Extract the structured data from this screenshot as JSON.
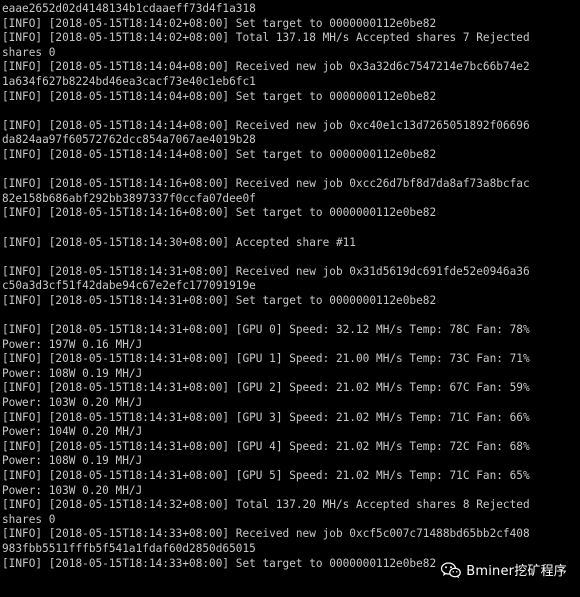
{
  "terminal": {
    "lines": [
      "eaae2652d02d4148134b1cdaaeff73d4f1a318",
      "[INFO] [2018-05-15T18:14:02+08:00] Set target to 0000000112e0be82",
      "[INFO] [2018-05-15T18:14:02+08:00] Total 137.18 MH/s Accepted shares 7 Rejected",
      "shares 0",
      "[INFO] [2018-05-15T18:14:04+08:00] Received new job 0x3a32d6c7547214e7bc66b74e2",
      "1a634f627b8224bd46ea3cacf73e40c1eb6fc1",
      "[INFO] [2018-05-15T18:14:04+08:00] Set target to 0000000112e0be82",
      "",
      "[INFO] [2018-05-15T18:14:14+08:00] Received new job 0xc40e1c13d7265051892f06696",
      "da824aa97f60572762dcc854a7067ae4019b28",
      "[INFO] [2018-05-15T18:14:14+08:00] Set target to 0000000112e0be82",
      "",
      "[INFO] [2018-05-15T18:14:16+08:00] Received new job 0xcc26d7bf8d7da8af73a8bcfac",
      "82e158b686abf292bb3897337f0ccfa07dee0f",
      "[INFO] [2018-05-15T18:14:16+08:00] Set target to 0000000112e0be82",
      "",
      "[INFO] [2018-05-15T18:14:30+08:00] Accepted share #11",
      "",
      "[INFO] [2018-05-15T18:14:31+08:00] Received new job 0x31d5619dc691fde52e0946a36",
      "c50a3d3cf51f42dabe94c67e2efc177091919e",
      "[INFO] [2018-05-15T18:14:31+08:00] Set target to 0000000112e0be82",
      "",
      "[INFO] [2018-05-15T18:14:31+08:00] [GPU 0] Speed: 32.12 MH/s Temp: 78C Fan: 78%",
      "Power: 197W 0.16 MH/J",
      "[INFO] [2018-05-15T18:14:31+08:00] [GPU 1] Speed: 21.00 MH/s Temp: 73C Fan: 71%",
      "Power: 108W 0.19 MH/J",
      "[INFO] [2018-05-15T18:14:31+08:00] [GPU 2] Speed: 21.02 MH/s Temp: 67C Fan: 59%",
      "Power: 103W 0.20 MH/J",
      "[INFO] [2018-05-15T18:14:31+08:00] [GPU 3] Speed: 21.02 MH/s Temp: 71C Fan: 66%",
      "Power: 104W 0.20 MH/J",
      "[INFO] [2018-05-15T18:14:31+08:00] [GPU 4] Speed: 21.02 MH/s Temp: 72C Fan: 68%",
      "Power: 108W 0.19 MH/J",
      "[INFO] [2018-05-15T18:14:31+08:00] [GPU 5] Speed: 21.02 MH/s Temp: 71C Fan: 65%",
      "Power: 103W 0.20 MH/J",
      "[INFO] [2018-05-15T18:14:32+08:00] Total 137.20 MH/s Accepted shares 8 Rejected",
      "shares 0",
      "[INFO] [2018-05-15T18:14:33+08:00] Received new job 0xcf5c007c71488bd65bb2cf408",
      "983fbb5511fffb5f541a1fdaf60d2850d65015",
      "[INFO] [2018-05-15T18:14:33+08:00] Set target to 0000000112e0be82"
    ]
  },
  "watermark": {
    "text": "Bminer挖矿程序",
    "icon": "wechat-icon"
  },
  "colors": {
    "background": "#000000",
    "text": "#c8c8c8",
    "watermark_text": "#ffffff"
  }
}
